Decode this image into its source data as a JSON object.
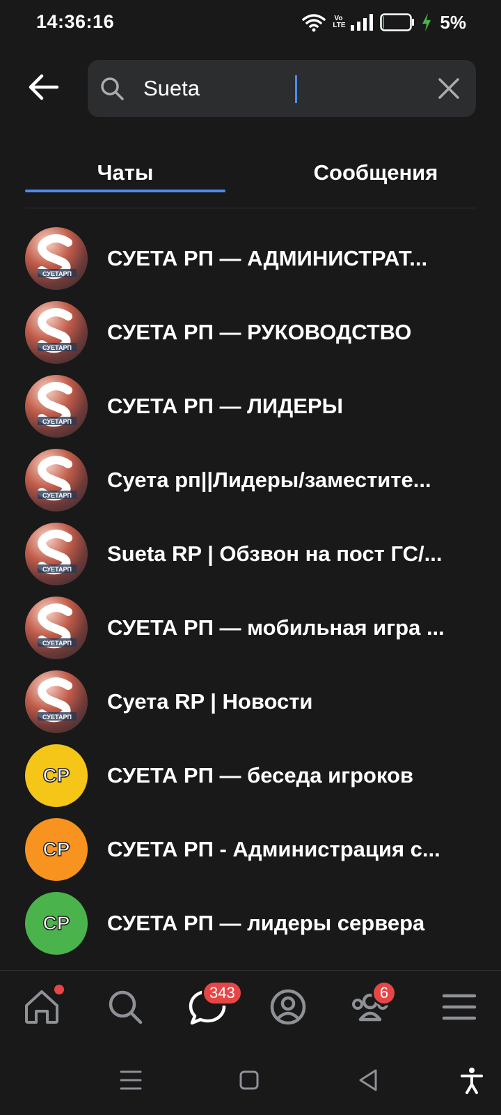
{
  "status_bar": {
    "time": "14:36:16",
    "network_label": "Vo LTE",
    "battery_percent": "5%",
    "battery_level": 0.05,
    "icons": [
      "wifi-icon",
      "volte-icon",
      "signal-icon",
      "battery-icon",
      "charging-icon"
    ]
  },
  "search": {
    "value": "Sueta",
    "back_icon": "arrow-left-icon",
    "search_icon": "search-icon",
    "clear_icon": "close-icon"
  },
  "tabs": [
    {
      "label": "Чаты",
      "active": true
    },
    {
      "label": "Сообщения",
      "active": false
    }
  ],
  "chats": [
    {
      "title": "СУЕТА РП — АДМИНИСТРАТ...",
      "avatar": "image",
      "avatar_logo_text": "СУЕТАРП"
    },
    {
      "title": "СУЕТА РП — РУКОВОДСТВО",
      "avatar": "image",
      "avatar_logo_text": "СУЕТАРП"
    },
    {
      "title": "СУЕТА РП — ЛИДЕРЫ",
      "avatar": "image",
      "avatar_logo_text": "СУЕТАРП"
    },
    {
      "title": "Суета рп||Лидеры/заместите...",
      "avatar": "image",
      "avatar_logo_text": "СУЕТАРП"
    },
    {
      "title": "Sueta RP | Обзвон на пост ГС/...",
      "avatar": "image",
      "avatar_logo_text": "СУЕТАРП"
    },
    {
      "title": "СУЕТА РП — мобильная игра ...",
      "avatar": "image",
      "avatar_logo_text": "СУЕТАРП"
    },
    {
      "title": "Суета RP | Новости",
      "avatar": "image",
      "avatar_logo_text": "СУЕТАРП"
    },
    {
      "title": "СУЕТА РП — беседа игроков",
      "avatar": "initials",
      "initials": "СР",
      "color": "#f5c518"
    },
    {
      "title": "СУЕТА РП - Администрация с...",
      "avatar": "initials",
      "initials": "СР",
      "color": "#f7931e"
    },
    {
      "title": "СУЕТА РП — лидеры сервера",
      "avatar": "initials",
      "initials": "СР",
      "color": "#4bb34b"
    }
  ],
  "bottom_nav": {
    "items": [
      "home-icon",
      "search-icon",
      "messages-icon",
      "profile-icon",
      "friends-icon",
      "menu-icon"
    ],
    "messages_badge": "343",
    "friends_badge": "6",
    "home_dot": true
  },
  "system_nav": [
    "recents-icon",
    "home-square-icon",
    "back-triangle-icon",
    "accessibility-icon"
  ],
  "colors": {
    "background": "#19191a",
    "accent": "#4a8cf0",
    "badge": "#e64646",
    "search_bg": "#2c2d2f"
  }
}
